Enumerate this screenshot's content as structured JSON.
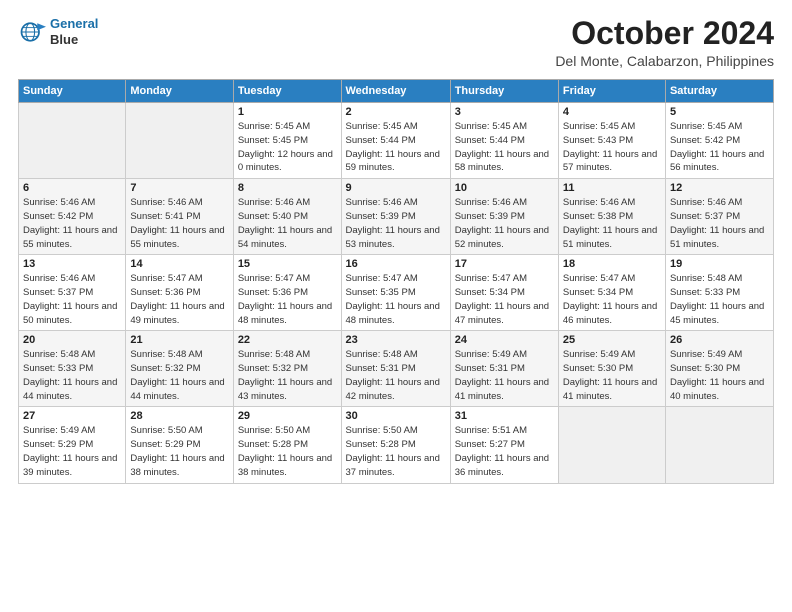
{
  "header": {
    "logo_line1": "General",
    "logo_line2": "Blue",
    "month": "October 2024",
    "location": "Del Monte, Calabarzon, Philippines"
  },
  "weekdays": [
    "Sunday",
    "Monday",
    "Tuesday",
    "Wednesday",
    "Thursday",
    "Friday",
    "Saturday"
  ],
  "weeks": [
    [
      {
        "day": "",
        "info": ""
      },
      {
        "day": "",
        "info": ""
      },
      {
        "day": "1",
        "info": "Sunrise: 5:45 AM\nSunset: 5:45 PM\nDaylight: 12 hours\nand 0 minutes."
      },
      {
        "day": "2",
        "info": "Sunrise: 5:45 AM\nSunset: 5:44 PM\nDaylight: 11 hours\nand 59 minutes."
      },
      {
        "day": "3",
        "info": "Sunrise: 5:45 AM\nSunset: 5:44 PM\nDaylight: 11 hours\nand 58 minutes."
      },
      {
        "day": "4",
        "info": "Sunrise: 5:45 AM\nSunset: 5:43 PM\nDaylight: 11 hours\nand 57 minutes."
      },
      {
        "day": "5",
        "info": "Sunrise: 5:45 AM\nSunset: 5:42 PM\nDaylight: 11 hours\nand 56 minutes."
      }
    ],
    [
      {
        "day": "6",
        "info": "Sunrise: 5:46 AM\nSunset: 5:42 PM\nDaylight: 11 hours\nand 55 minutes."
      },
      {
        "day": "7",
        "info": "Sunrise: 5:46 AM\nSunset: 5:41 PM\nDaylight: 11 hours\nand 55 minutes."
      },
      {
        "day": "8",
        "info": "Sunrise: 5:46 AM\nSunset: 5:40 PM\nDaylight: 11 hours\nand 54 minutes."
      },
      {
        "day": "9",
        "info": "Sunrise: 5:46 AM\nSunset: 5:39 PM\nDaylight: 11 hours\nand 53 minutes."
      },
      {
        "day": "10",
        "info": "Sunrise: 5:46 AM\nSunset: 5:39 PM\nDaylight: 11 hours\nand 52 minutes."
      },
      {
        "day": "11",
        "info": "Sunrise: 5:46 AM\nSunset: 5:38 PM\nDaylight: 11 hours\nand 51 minutes."
      },
      {
        "day": "12",
        "info": "Sunrise: 5:46 AM\nSunset: 5:37 PM\nDaylight: 11 hours\nand 51 minutes."
      }
    ],
    [
      {
        "day": "13",
        "info": "Sunrise: 5:46 AM\nSunset: 5:37 PM\nDaylight: 11 hours\nand 50 minutes."
      },
      {
        "day": "14",
        "info": "Sunrise: 5:47 AM\nSunset: 5:36 PM\nDaylight: 11 hours\nand 49 minutes."
      },
      {
        "day": "15",
        "info": "Sunrise: 5:47 AM\nSunset: 5:36 PM\nDaylight: 11 hours\nand 48 minutes."
      },
      {
        "day": "16",
        "info": "Sunrise: 5:47 AM\nSunset: 5:35 PM\nDaylight: 11 hours\nand 48 minutes."
      },
      {
        "day": "17",
        "info": "Sunrise: 5:47 AM\nSunset: 5:34 PM\nDaylight: 11 hours\nand 47 minutes."
      },
      {
        "day": "18",
        "info": "Sunrise: 5:47 AM\nSunset: 5:34 PM\nDaylight: 11 hours\nand 46 minutes."
      },
      {
        "day": "19",
        "info": "Sunrise: 5:48 AM\nSunset: 5:33 PM\nDaylight: 11 hours\nand 45 minutes."
      }
    ],
    [
      {
        "day": "20",
        "info": "Sunrise: 5:48 AM\nSunset: 5:33 PM\nDaylight: 11 hours\nand 44 minutes."
      },
      {
        "day": "21",
        "info": "Sunrise: 5:48 AM\nSunset: 5:32 PM\nDaylight: 11 hours\nand 44 minutes."
      },
      {
        "day": "22",
        "info": "Sunrise: 5:48 AM\nSunset: 5:32 PM\nDaylight: 11 hours\nand 43 minutes."
      },
      {
        "day": "23",
        "info": "Sunrise: 5:48 AM\nSunset: 5:31 PM\nDaylight: 11 hours\nand 42 minutes."
      },
      {
        "day": "24",
        "info": "Sunrise: 5:49 AM\nSunset: 5:31 PM\nDaylight: 11 hours\nand 41 minutes."
      },
      {
        "day": "25",
        "info": "Sunrise: 5:49 AM\nSunset: 5:30 PM\nDaylight: 11 hours\nand 41 minutes."
      },
      {
        "day": "26",
        "info": "Sunrise: 5:49 AM\nSunset: 5:30 PM\nDaylight: 11 hours\nand 40 minutes."
      }
    ],
    [
      {
        "day": "27",
        "info": "Sunrise: 5:49 AM\nSunset: 5:29 PM\nDaylight: 11 hours\nand 39 minutes."
      },
      {
        "day": "28",
        "info": "Sunrise: 5:50 AM\nSunset: 5:29 PM\nDaylight: 11 hours\nand 38 minutes."
      },
      {
        "day": "29",
        "info": "Sunrise: 5:50 AM\nSunset: 5:28 PM\nDaylight: 11 hours\nand 38 minutes."
      },
      {
        "day": "30",
        "info": "Sunrise: 5:50 AM\nSunset: 5:28 PM\nDaylight: 11 hours\nand 37 minutes."
      },
      {
        "day": "31",
        "info": "Sunrise: 5:51 AM\nSunset: 5:27 PM\nDaylight: 11 hours\nand 36 minutes."
      },
      {
        "day": "",
        "info": ""
      },
      {
        "day": "",
        "info": ""
      }
    ]
  ]
}
